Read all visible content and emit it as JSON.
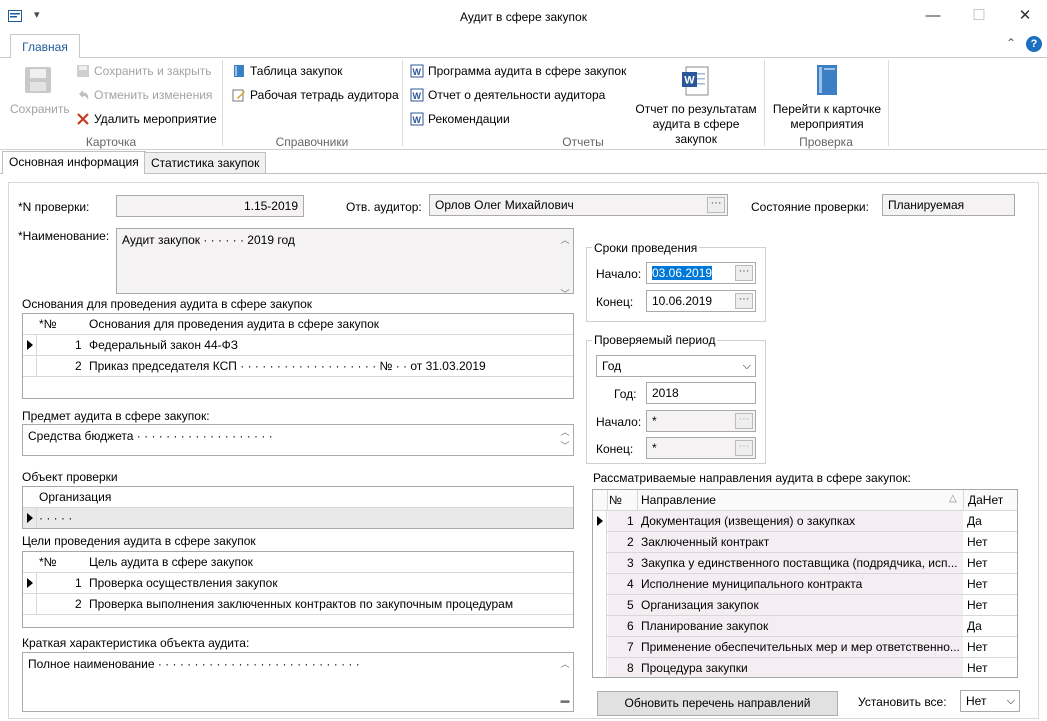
{
  "window": {
    "title": "Аудит в сфере закупок"
  },
  "ribbon": {
    "tab": "Главная",
    "save": "Сохранить",
    "save_close": "Сохранить и закрыть",
    "cancel_changes": "Отменить изменения",
    "delete_event": "Удалить мероприятие",
    "group_card": "Карточка",
    "purchases_table": "Таблица закупок",
    "auditor_workbook": "Рабочая тетрадь аудитора",
    "group_refs": "Справочники",
    "audit_program": "Программа аудита в сфере закупок",
    "activity_report": "Отчет о деятельности аудитора",
    "recommendations": "Рекомендации",
    "results_report_1": "Отчет по результатам",
    "results_report_2": "аудита в сфере закупок",
    "group_reports": "Отчеты",
    "goto_card_1": "Перейти к карточке",
    "goto_card_2": "мероприятия",
    "group_check": "Проверка"
  },
  "tabs": [
    "Основная информация",
    "Статистика закупок"
  ],
  "form": {
    "check_no_label": "*N проверки:",
    "check_no": "1.15-2019",
    "auditor_label": "Отв. аудитор:",
    "auditor": "Орлов Олег Михайлович",
    "state_label": "Состояние проверки:",
    "state": "Планируемая",
    "name_label": "*Наименование:",
    "name": "Аудит закупок · · · · · · 2019 год",
    "grounds_title": "Основания для проведения аудита в сфере закупок",
    "grounds_cols": [
      "*№",
      "Основания для проведения аудита в сфере закупок"
    ],
    "grounds_rows": [
      {
        "n": "1",
        "text": "Федеральный закон 44-ФЗ"
      },
      {
        "n": "2",
        "text": "Приказ председателя КСП · · · · · · · · · · · · · · · · · · · № · · от 31.03.2019"
      }
    ],
    "subject_label": "Предмет аудита в сфере закупок:",
    "subject": "Средства бюджета · · · · · · · · · · · · · · · · · · ·",
    "object_title": "Объект проверки",
    "object_col": "Организация",
    "object_row": "· · · · ·",
    "goals_title": "Цели проведения аудита в сфере закупок",
    "goals_cols": [
      "*№",
      "Цель аудита в сфере закупок"
    ],
    "goals_rows": [
      {
        "n": "1",
        "text": "Проверка осуществления закупок"
      },
      {
        "n": "2",
        "text": "Проверка выполнения заключенных контрактов по закупочным процедурам"
      }
    ],
    "charact_label": "Краткая характеристика объекта аудита:",
    "charact": "Полное наименование · · · · · · · · · · · · · · · · · · · · · · · · · · · ·"
  },
  "terms": {
    "title": "Сроки проведения",
    "start_label": "Начало:",
    "start": "03.06.2019",
    "end_label": "Конец:",
    "end": "10.06.2019"
  },
  "period": {
    "title": "Проверяемый период",
    "type": "Год",
    "year_label": "Год:",
    "year": "2018",
    "start_label": "Начало:",
    "start": "*",
    "end_label": "Конец:",
    "end": "*"
  },
  "directions": {
    "title": "Рассматриваемые направления аудита в сфере закупок:",
    "cols": [
      "№",
      "Направление",
      "ДаНет"
    ],
    "rows": [
      {
        "n": "1",
        "text": "Документация (извещения) о закупках",
        "val": "Да"
      },
      {
        "n": "2",
        "text": "Заключенный контракт",
        "val": "Нет"
      },
      {
        "n": "3",
        "text": "Закупка у единственного поставщика (подрядчика, исп...",
        "val": "Нет"
      },
      {
        "n": "4",
        "text": "Исполнение муниципального контракта",
        "val": "Нет"
      },
      {
        "n": "5",
        "text": "Организация закупок",
        "val": "Нет"
      },
      {
        "n": "6",
        "text": "Планирование закупок",
        "val": "Да"
      },
      {
        "n": "7",
        "text": "Применение обеспечительных мер и мер ответственно...",
        "val": "Нет"
      },
      {
        "n": "8",
        "text": "Процедура закупки",
        "val": "Нет"
      }
    ],
    "refresh_button": "Обновить перечень направлений",
    "set_all_label": "Установить все:",
    "set_all": "Нет"
  }
}
